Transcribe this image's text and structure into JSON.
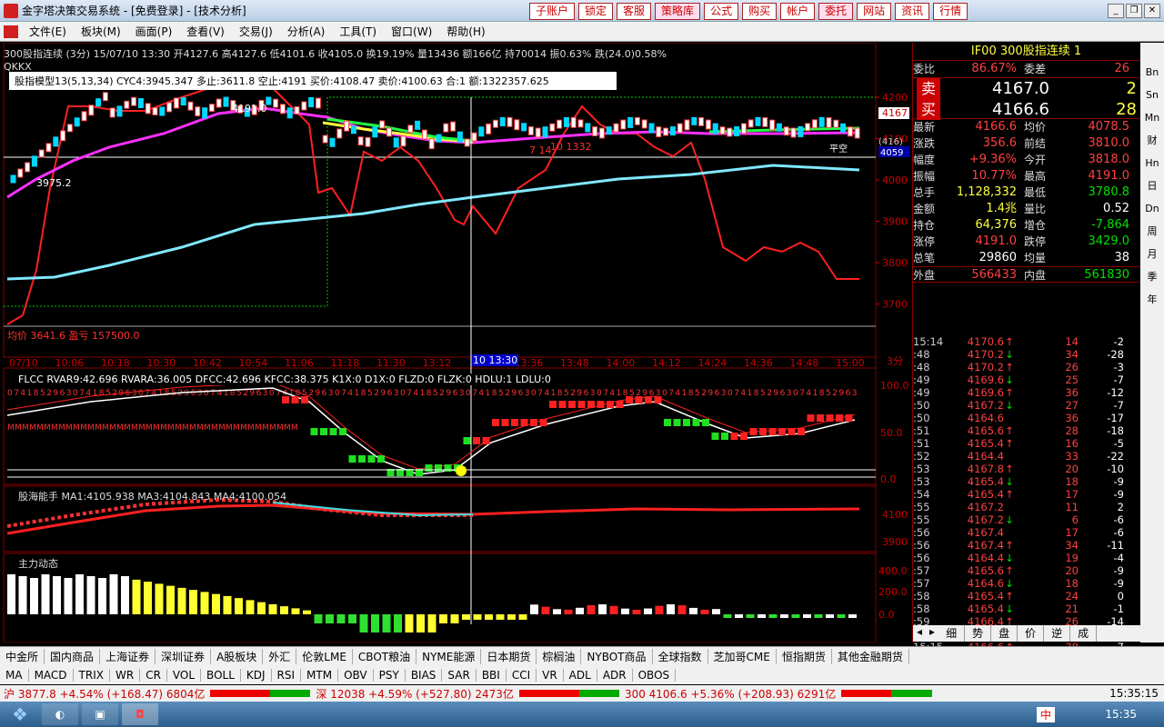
{
  "window": {
    "title": "金字塔决策交易系统 - [免费登录] - [技术分析]",
    "top_buttons": [
      "子账户",
      "锁定",
      "客服",
      "策略库",
      "公式",
      "购买",
      "帐户",
      "委托",
      "网站",
      "资讯",
      "行情"
    ]
  },
  "menu": [
    "文件(E)",
    "板块(M)",
    "画面(P)",
    "查看(V)",
    "交易(J)",
    "分析(A)",
    "工具(T)",
    "窗口(W)",
    "帮助(H)"
  ],
  "main_chart": {
    "info": "300股指连续 (3分) 15/07/10 13:30 开4127.6 高4127.6 低4101.6 收4105.0 换19.19% 量13436 额166亿 持70014 振0.63% 跌(24.0)0.58%",
    "label": "QKKX",
    "model": "股指模型13(5,13,34) CYC4:3945.347 多止:3611.8 空止:4191 买价:4108.47 卖价:4100.63 合:1 额:1322357.625",
    "y_labels": [
      "4200",
      "4100",
      "4000",
      "3900",
      "3800",
      "3700"
    ],
    "annotations": {
      "high": "4191.0",
      "low": "3975.2",
      "bottom": "均价 3641.6 盈亏 157500.0",
      "price_tag": "4167",
      "tag2": "(416)",
      "tag3": "4059",
      "peak_label": "7 14",
      "mid_label": "10 1332",
      "pingkong": "平空"
    },
    "time_labels": [
      "07/10",
      "10:06",
      "10:18",
      "10:30",
      "10:42",
      "10:54",
      "11:06",
      "11:18",
      "11:30",
      "13:12",
      "13:24",
      "13:36",
      "13:48",
      "14:00",
      "14:12",
      "14:24",
      "14:36",
      "14:48",
      "15:00"
    ],
    "cursor_time": "10 13:30",
    "period": "3分"
  },
  "flcc_panel": {
    "info": "FLCC RVAR9:42.696 RVARA:36.005 DFCC:42.696 KFCC:38.375 K1X:0 D1X:0 FLZD:0 FLZK:0 HDLU:1 LDLU:0",
    "y_labels": [
      "100.0",
      "50.0",
      "0.0"
    ]
  },
  "ma_panel": {
    "info": "股海能手 MA1:4105.938 MA3:4104.843 MA4:4100.054",
    "y_labels": [
      "4100",
      "3900"
    ]
  },
  "force_panel": {
    "info": "主力动态",
    "y_labels": [
      "400.0",
      "200.0",
      "0.0"
    ]
  },
  "quote": {
    "code": "IF00",
    "name": "300股指连续",
    "num": "1",
    "rows": [
      {
        "k": "委比",
        "v": "86.67%",
        "k2": "委差",
        "v2": "26"
      },
      {
        "k": "最新",
        "v": "4166.6",
        "k2": "均价",
        "v2": "4078.5"
      },
      {
        "k": "涨跌",
        "v": "356.6",
        "k2": "前结",
        "v2": "3810.0"
      },
      {
        "k": "幅度",
        "v": "+9.36%",
        "k2": "今开",
        "v2": "3818.0"
      },
      {
        "k": "振幅",
        "v": "10.77%",
        "k2": "最高",
        "v2": "4191.0"
      },
      {
        "k": "总手",
        "v": "1,128,332",
        "k2": "最低",
        "v2": "3780.8"
      },
      {
        "k": "金额",
        "v": "1.4兆",
        "k2": "量比",
        "v2": "0.52"
      },
      {
        "k": "持仓",
        "v": "64,376",
        "k2": "增仓",
        "v2": "-7,864"
      },
      {
        "k": "涨停",
        "v": "4191.0",
        "k2": "跌停",
        "v2": "3429.0"
      },
      {
        "k": "总笔",
        "v": "29860",
        "k2": "均量",
        "v2": "38"
      }
    ],
    "sell": {
      "label": "卖",
      "price": "4167.0",
      "vol": "2"
    },
    "buy": {
      "label": "买",
      "price": "4166.6",
      "vol": "28"
    },
    "outer": {
      "k": "外盘",
      "v": "566433",
      "k2": "内盘",
      "v2": "561830"
    },
    "ticks": [
      {
        "t": "15:14",
        "p": "4170.6",
        "a": "↑",
        "v": "14",
        "c": "-2"
      },
      {
        "t": ":48",
        "p": "4170.2",
        "a": "↓",
        "v": "34",
        "c": "-28"
      },
      {
        "t": ":48",
        "p": "4170.2",
        "a": "↑",
        "v": "26",
        "c": "-3"
      },
      {
        "t": ":49",
        "p": "4169.6",
        "a": "↓",
        "v": "25",
        "c": "-7"
      },
      {
        "t": ":49",
        "p": "4169.6",
        "a": "↑",
        "v": "36",
        "c": "-12"
      },
      {
        "t": ":50",
        "p": "4167.2",
        "a": "↓",
        "v": "27",
        "c": "-7"
      },
      {
        "t": ":50",
        "p": "4164.6",
        "a": "",
        "v": "36",
        "c": "-17"
      },
      {
        "t": ":51",
        "p": "4165.6",
        "a": "↑",
        "v": "28",
        "c": "-18"
      },
      {
        "t": ":51",
        "p": "4165.4",
        "a": "↑",
        "v": "16",
        "c": "-5"
      },
      {
        "t": ":52",
        "p": "4164.4",
        "a": "",
        "v": "33",
        "c": "-22"
      },
      {
        "t": ":53",
        "p": "4167.8",
        "a": "↑",
        "v": "20",
        "c": "-10"
      },
      {
        "t": ":53",
        "p": "4165.4",
        "a": "↓",
        "v": "18",
        "c": "-9"
      },
      {
        "t": ":54",
        "p": "4165.4",
        "a": "↑",
        "v": "17",
        "c": "-9"
      },
      {
        "t": ":55",
        "p": "4167.2",
        "a": "",
        "v": "11",
        "c": "2"
      },
      {
        "t": ":55",
        "p": "4167.2",
        "a": "↓",
        "v": "6",
        "c": "-6"
      },
      {
        "t": ":56",
        "p": "4167.4",
        "a": "",
        "v": "17",
        "c": "-6"
      },
      {
        "t": ":56",
        "p": "4167.4",
        "a": "↑",
        "v": "34",
        "c": "-11"
      },
      {
        "t": ":56",
        "p": "4164.4",
        "a": "↓",
        "v": "19",
        "c": "-4"
      },
      {
        "t": ":57",
        "p": "4165.6",
        "a": "↑",
        "v": "20",
        "c": "-9"
      },
      {
        "t": ":57",
        "p": "4164.6",
        "a": "↓",
        "v": "18",
        "c": "-9"
      },
      {
        "t": ":58",
        "p": "4165.4",
        "a": "↑",
        "v": "24",
        "c": "0"
      },
      {
        "t": ":58",
        "p": "4165.4",
        "a": "↓",
        "v": "21",
        "c": "-1"
      },
      {
        "t": ":59",
        "p": "4166.4",
        "a": "↑",
        "v": "26",
        "c": "-14"
      },
      {
        "t": ":59",
        "p": "4165.6",
        "a": "↓",
        "v": "11",
        "c": "-6"
      },
      {
        "t": "15:15",
        "p": "4166.6",
        "a": "↑",
        "v": "38",
        "c": "-7"
      }
    ],
    "bottom_tabs": [
      "细",
      "势",
      "盘",
      "价",
      "逆",
      "成"
    ]
  },
  "right_sidebar": [
    "Bn",
    "Sn",
    "Mn",
    "财",
    "Hn",
    "日",
    "Dn",
    "周",
    "月",
    "季",
    "年"
  ],
  "tabs1": [
    "中金所",
    "国内商品",
    "上海证券",
    "深圳证券",
    "A股板块",
    "外汇",
    "伦敦LME",
    "CBOT粮油",
    "NYME能源",
    "日本期货",
    "棕榈油",
    "NYBOT商品",
    "全球指数",
    "芝加哥CME",
    "恒指期货",
    "其他金融期货"
  ],
  "tabs2": [
    "MA",
    "MACD",
    "TRIX",
    "WR",
    "CR",
    "VOL",
    "BOLL",
    "KDJ",
    "RSI",
    "MTM",
    "OBV",
    "PSY",
    "BIAS",
    "SAR",
    "BBI",
    "CCI",
    "VR",
    "ADL",
    "ADR",
    "OBOS"
  ],
  "status": {
    "sh": "沪 3877.8 +4.54% (+168.47) 6804亿",
    "sz": "深 12038 +4.59% (+527.80) 2473亿",
    "hs": "300 4106.6 +5.36% (+208.93) 6291亿",
    "time": "15:35:15"
  },
  "taskbar": {
    "clock": "15:35",
    "ime": "中"
  },
  "colors": {
    "up": "#ff3030",
    "down": "#00e000",
    "bg": "#000000",
    "cyan": "#60e0f0",
    "magenta": "#ff30ff"
  }
}
